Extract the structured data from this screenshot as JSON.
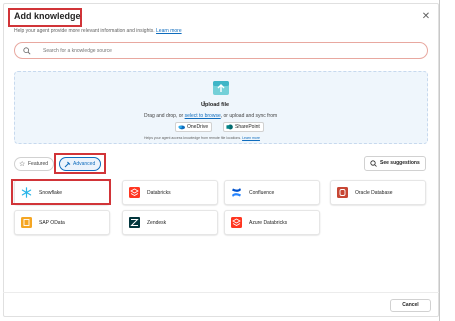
{
  "dialog": {
    "title": "Add knowledge",
    "subtitle": "Help your agent provide more relevant information and insights.",
    "learn_more": "Learn more",
    "close_icon": "close-icon"
  },
  "search": {
    "placeholder": "Search for a knowledge source",
    "icon": "search-icon"
  },
  "upload": {
    "title": "Upload file",
    "drag_prefix": "Drag and drop, or ",
    "browse_link": "select to browse",
    "drag_suffix": ", or upload and sync from",
    "onedrive": "OneDrive",
    "sharepoint": "SharePoint",
    "helper": "Helps your agent access knowledge from remote file locations.",
    "helper_link": "Learn more"
  },
  "tabs": {
    "featured": "Featured",
    "advanced": "Advanced"
  },
  "see_suggestions": "See suggestions",
  "sources": [
    {
      "name": "Snowflake",
      "color": "#29b5e8"
    },
    {
      "name": "Databricks",
      "color": "#ff3621"
    },
    {
      "name": "Confluence",
      "color": "#2684ff"
    },
    {
      "name": "Oracle Database",
      "color": "#c74634"
    },
    {
      "name": "SAP OData",
      "color": "#f5a623"
    },
    {
      "name": "Zendesk",
      "color": "#03363d"
    },
    {
      "name": "Azure Databricks",
      "color": "#ff3621"
    }
  ],
  "footer": {
    "cancel": "Cancel"
  },
  "colors": {
    "accent": "#0f6cbd",
    "highlight": "#d13438"
  }
}
